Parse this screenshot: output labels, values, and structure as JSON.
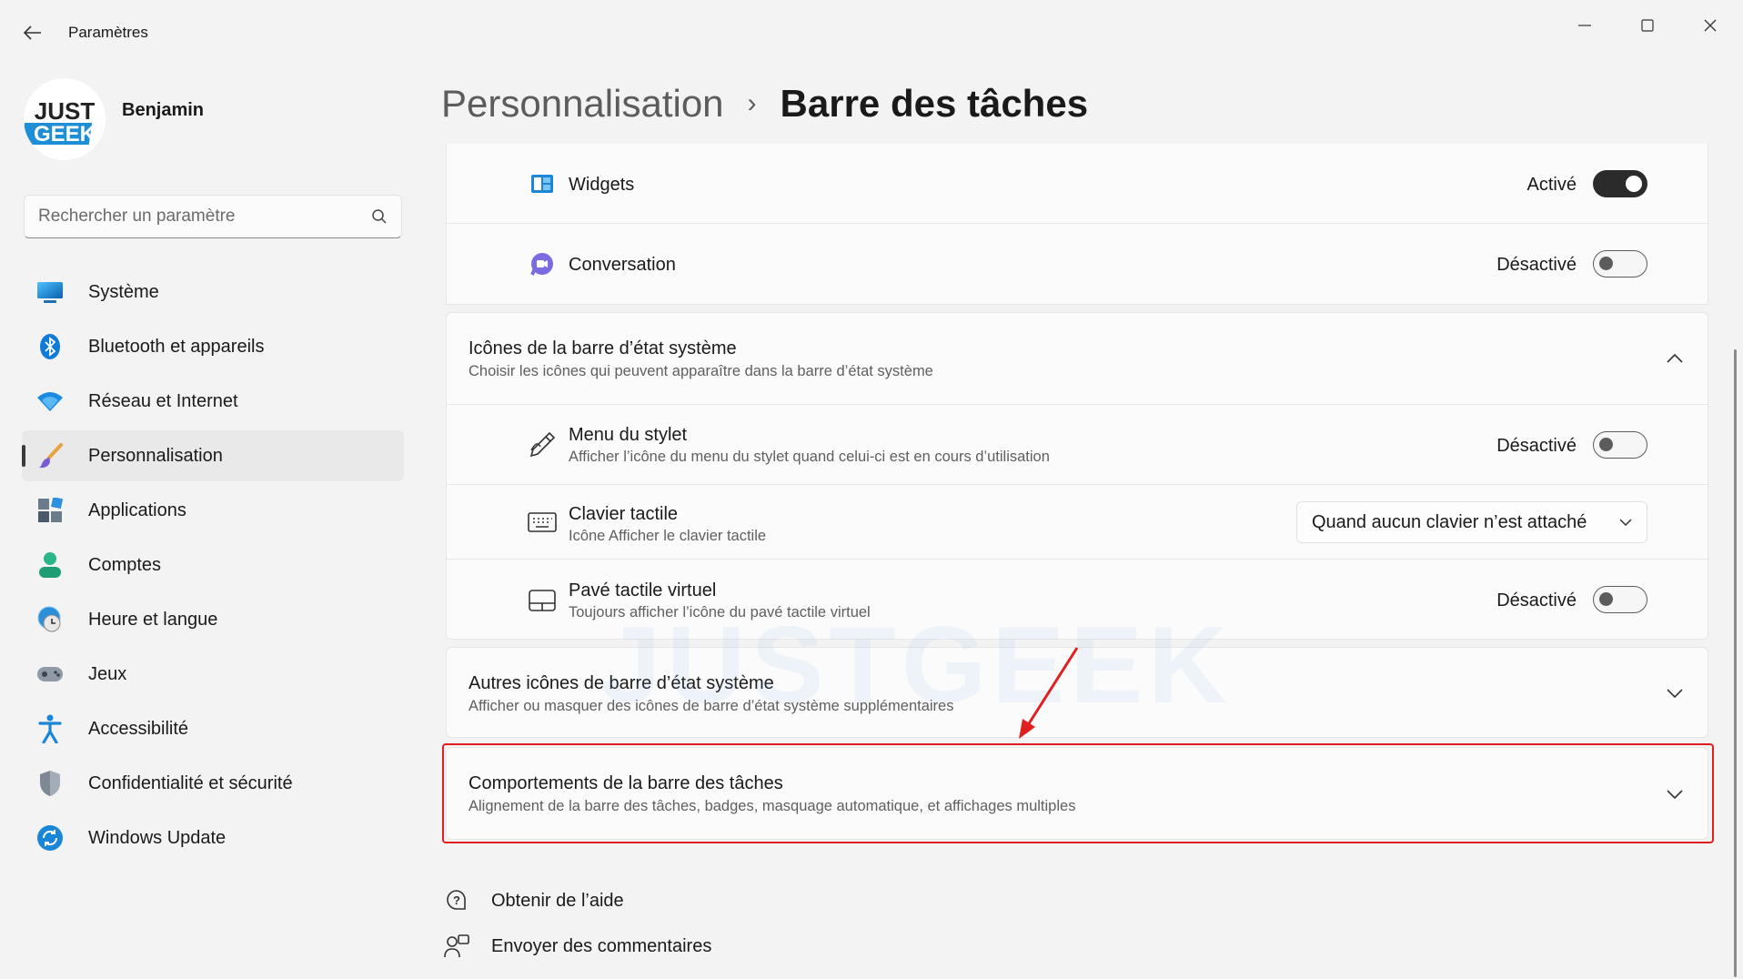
{
  "window": {
    "title": "Paramètres"
  },
  "profile": {
    "name": "Benjamin",
    "logo_line1": "JUST",
    "logo_line2": "GEEK"
  },
  "search": {
    "placeholder": "Rechercher un paramètre"
  },
  "sidebar": {
    "items": [
      {
        "label": "Système",
        "icon": "monitor-icon"
      },
      {
        "label": "Bluetooth et appareils",
        "icon": "bluetooth-icon"
      },
      {
        "label": "Réseau et Internet",
        "icon": "wifi-icon"
      },
      {
        "label": "Personnalisation",
        "icon": "brush-icon",
        "active": true
      },
      {
        "label": "Applications",
        "icon": "apps-icon"
      },
      {
        "label": "Comptes",
        "icon": "account-icon"
      },
      {
        "label": "Heure et langue",
        "icon": "globe-clock-icon"
      },
      {
        "label": "Jeux",
        "icon": "gamepad-icon"
      },
      {
        "label": "Accessibilité",
        "icon": "accessibility-icon"
      },
      {
        "label": "Confidentialité et sécurité",
        "icon": "shield-icon"
      },
      {
        "label": "Windows Update",
        "icon": "update-icon"
      }
    ]
  },
  "breadcrumb": {
    "parent": "Personnalisation",
    "separator": "›",
    "current": "Barre des tâches"
  },
  "taskbar_items": {
    "widgets": {
      "label": "Widgets",
      "state": "Activé",
      "on": true
    },
    "conversation": {
      "label": "Conversation",
      "state": "Désactivé",
      "on": false
    }
  },
  "tray_icons": {
    "title": "Icônes de la barre d’état système",
    "subtitle": "Choisir les icônes qui peuvent apparaître dans la barre d’état système",
    "pen_menu": {
      "title": "Menu du stylet",
      "subtitle": "Afficher l’icône du menu du stylet quand celui-ci est en cours d’utilisation",
      "state": "Désactivé"
    },
    "touch_keyboard": {
      "title": "Clavier tactile",
      "subtitle": "Icône Afficher le clavier tactile",
      "selected": "Quand aucun clavier n’est attaché"
    },
    "virtual_touchpad": {
      "title": "Pavé tactile virtuel",
      "subtitle": "Toujours afficher l’icône du pavé tactile virtuel",
      "state": "Désactivé"
    }
  },
  "other_tray": {
    "title": "Autres icônes de barre d’état système",
    "subtitle": "Afficher ou masquer des icônes de barre d’état système supplémentaires"
  },
  "behaviors": {
    "title": "Comportements de la barre des tâches",
    "subtitle": "Alignement de la barre des tâches, badges, masquage automatique, et affichages multiples"
  },
  "footer": {
    "help": "Obtenir de l’aide",
    "feedback": "Envoyer des commentaires"
  },
  "watermark": "JUSTGEEK",
  "colors": {
    "accent": "#0067c0",
    "highlight": "#e02020",
    "toggle_on": "#2b2b2b"
  }
}
